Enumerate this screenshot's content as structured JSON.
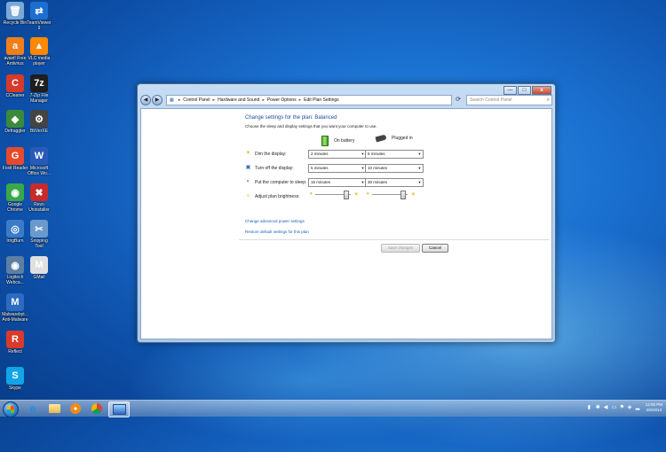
{
  "desktop": {
    "icons": [
      {
        "label": "Recycle Bin",
        "glyph": "🗑",
        "bg": "#7aa9d6"
      },
      {
        "label": "TeamViewer\n9",
        "glyph": "⇄",
        "bg": "#1c6fd1"
      },
      {
        "label": "avast! Free\nAntivirus",
        "glyph": "a",
        "bg": "#f07f1a"
      },
      {
        "label": "VLC media\nplayer",
        "glyph": "▲",
        "bg": "#ff8800"
      },
      {
        "label": "CCleaner",
        "glyph": "C",
        "bg": "#d63a2b"
      },
      {
        "label": "7-Zip File\nManager",
        "glyph": "7z",
        "bg": "#1e1e1e"
      },
      {
        "label": "Defraggler",
        "glyph": "◆",
        "bg": "#3a8a3a"
      },
      {
        "label": "BitVerXE",
        "glyph": "⚙",
        "bg": "#444444"
      },
      {
        "label": "Foxit Reader",
        "glyph": "G",
        "bg": "#e8492c"
      },
      {
        "label": "Microsoft\nOffice Wo...",
        "glyph": "W",
        "bg": "#2a5ab8"
      },
      {
        "label": "Google\nChrome",
        "glyph": "◉",
        "bg": "#3aa74a"
      },
      {
        "label": "Revo\nUninstaller",
        "glyph": "✖",
        "bg": "#c72b2b"
      },
      {
        "label": "IrngBurn",
        "glyph": "◎",
        "bg": "#3a7cc8"
      },
      {
        "label": "Snipping\nTool",
        "glyph": "✂",
        "bg": "#6a9acb"
      },
      {
        "label": "Logitech\nWebca...",
        "glyph": "◉",
        "bg": "#5c7fa3"
      },
      {
        "label": "GMail",
        "glyph": "M",
        "bg": "#e0e0e0"
      },
      {
        "label": "Malwarebyt...\nAnti-Malware",
        "glyph": "M",
        "bg": "#2d6bc2"
      },
      {
        "label": "Reflect",
        "glyph": "R",
        "bg": "#d93a2b"
      },
      {
        "label": "Skype",
        "glyph": "S",
        "bg": "#11a5e8"
      }
    ]
  },
  "window": {
    "minimize": "—",
    "maximize": "□",
    "close": "x",
    "back": "◀",
    "forward": "▶",
    "breadcrumb": [
      "Control Panel",
      "Hardware and Sound",
      "Power Options",
      "Edit Plan Settings"
    ],
    "search_placeholder": "Search Control Panel",
    "refresh_glyph": "⟳",
    "search_glyph": "⌕",
    "title": "Change settings for the plan: Balanced",
    "subtitle": "Choose the sleep and display settings that you want your computer to use.",
    "on_battery": "On battery",
    "plugged_in": "Plugged in",
    "rows": [
      {
        "label": "Dim the display:",
        "battery": "2 minutes",
        "plugged": "5 minutes",
        "icon": "☀"
      },
      {
        "label": "Turn off the display:",
        "battery": "5 minutes",
        "plugged": "10 minutes",
        "icon": "▣"
      },
      {
        "label": "Put the computer to sleep:",
        "battery": "15 minutes",
        "plugged": "30 minutes",
        "icon": "◐"
      }
    ],
    "brightness_label": "Adjust plan brightness:",
    "brightness_battery": 0.9,
    "brightness_plugged": 0.9,
    "link_advanced": "Change advanced power settings",
    "link_restore": "Restore default settings for this plan",
    "save_button": "Save changes",
    "cancel_button": "Cancel"
  },
  "taskbar": {
    "clock_time": "12:05 PM",
    "clock_date": "2/6/2013"
  }
}
